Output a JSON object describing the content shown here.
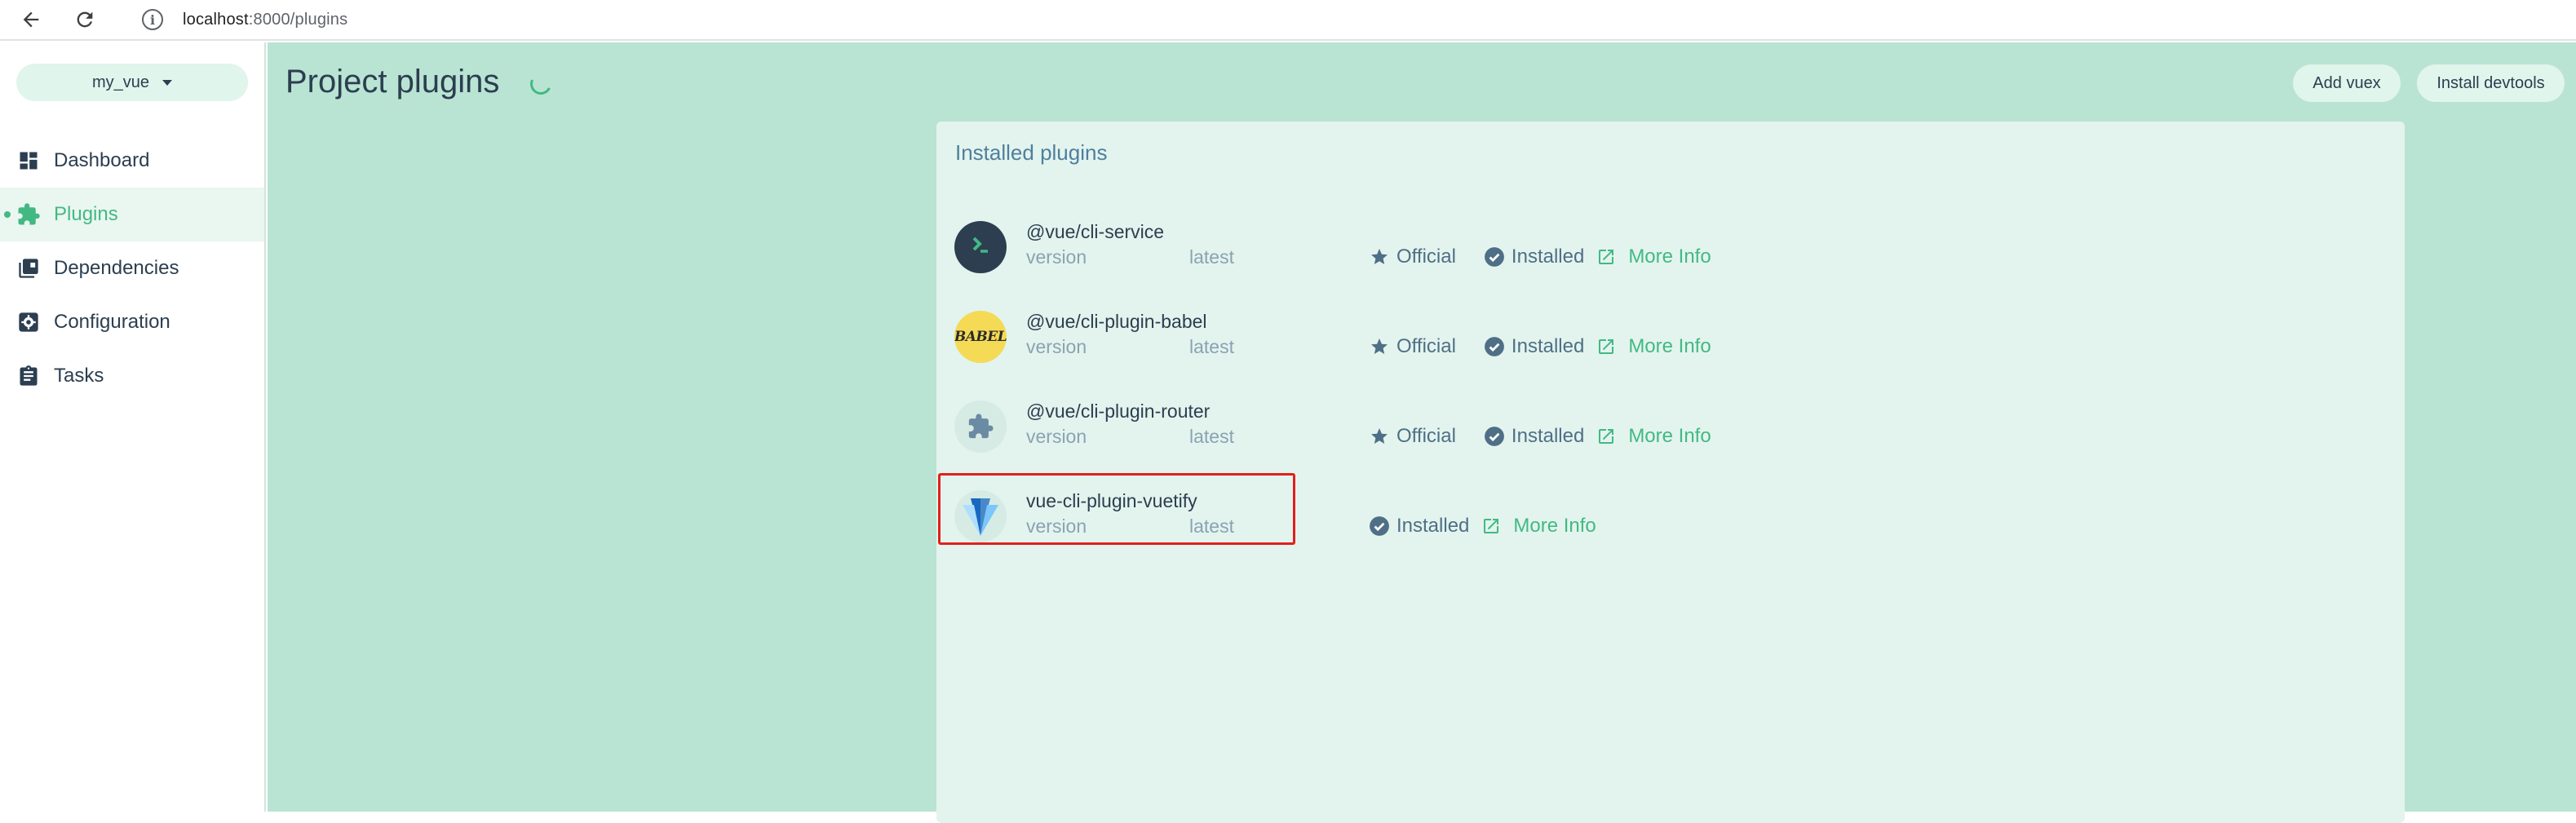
{
  "browser": {
    "url_host": "localhost",
    "url_rest": ":8000/plugins"
  },
  "sidebar": {
    "project_name": "my_vue",
    "items": [
      {
        "label": "Dashboard",
        "icon": "dashboard-icon",
        "active": false
      },
      {
        "label": "Plugins",
        "icon": "puzzle-icon",
        "active": true
      },
      {
        "label": "Dependencies",
        "icon": "library-icon",
        "active": false
      },
      {
        "label": "Configuration",
        "icon": "settings-box-icon",
        "active": false
      },
      {
        "label": "Tasks",
        "icon": "clipboard-icon",
        "active": false
      }
    ]
  },
  "header": {
    "title": "Project plugins",
    "add_vuex_label": "Add vuex",
    "install_devtools_label": "Install devtools"
  },
  "panel": {
    "title": "Installed plugins",
    "plugins": [
      {
        "name": "@vue/cli-service",
        "version_label": "version",
        "version_value": "latest",
        "official_label": "Official",
        "installed_label": "Installed",
        "more_info_label": "More Info",
        "logo": "cli-terminal-logo"
      },
      {
        "name": "@vue/cli-plugin-babel",
        "version_label": "version",
        "version_value": "latest",
        "official_label": "Official",
        "installed_label": "Installed",
        "more_info_label": "More Info",
        "logo": "babel-logo",
        "logo_text": "BABEL"
      },
      {
        "name": "@vue/cli-plugin-router",
        "version_label": "version",
        "version_value": "latest",
        "official_label": "Official",
        "installed_label": "Installed",
        "more_info_label": "More Info",
        "logo": "puzzle-logo"
      },
      {
        "name": "vue-cli-plugin-vuetify",
        "version_label": "version",
        "version_value": "latest",
        "installed_label": "Installed",
        "more_info_label": "More Info",
        "logo": "vuetify-logo"
      }
    ]
  },
  "colors": {
    "accent": "#42b983",
    "main_bg": "#b9e4d3",
    "panel_bg": "#e3f4ee",
    "highlight": "#e0201c"
  }
}
